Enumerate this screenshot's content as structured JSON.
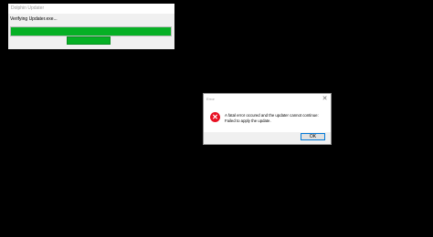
{
  "updater": {
    "title": "Dolphin Updater",
    "status": "Verifying Updater.exe...",
    "progress": 1.0,
    "accent_color": "#06b025"
  },
  "error_dialog": {
    "title": "Error",
    "close_symbol": "✕",
    "icon": "error-icon",
    "icon_glyph": "✕",
    "message_line1": "A fatal error occured and the updater cannot continue:",
    "message_line2": "Failed to apply the update.",
    "ok_label": "OK"
  }
}
